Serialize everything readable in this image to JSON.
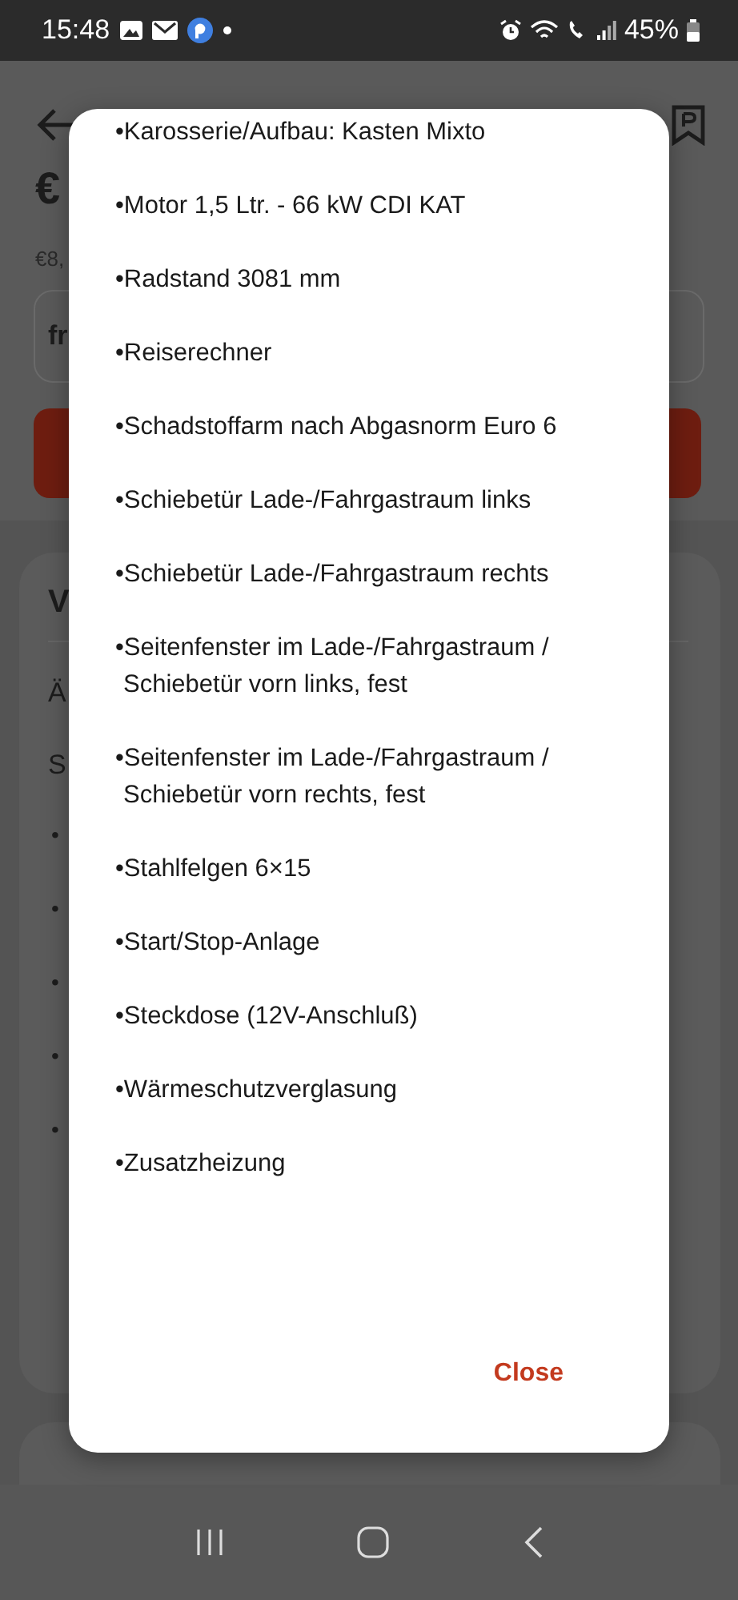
{
  "status_bar": {
    "time": "15:48",
    "battery": "45%"
  },
  "background": {
    "price": "€",
    "price_note": "€8,",
    "field_text": "fr",
    "section_title": "V",
    "rows": [
      "Ä",
      "S"
    ],
    "bullets": [
      "•",
      "•",
      "•",
      "•",
      "•"
    ]
  },
  "dialog": {
    "items": [
      "•Karosserie/Aufbau: Kasten Mixto",
      "•Motor 1,5 Ltr. - 66 kW CDI KAT",
      "•Radstand 3081 mm",
      "•Reiserechner",
      "•Schadstoffarm nach Abgasnorm Euro 6",
      "•Schiebetür Lade-/Fahrgastraum links",
      "•Schiebetür Lade-/Fahrgastraum rechts",
      "•Seitenfenster im Lade-/Fahrgastraum / Schiebetür vorn links, fest",
      "•Seitenfenster im Lade-/Fahrgastraum / Schiebetür vorn rechts, fest",
      "•Stahlfelgen 6×15",
      "•Start/Stop-Anlage",
      "•Steckdose (12V-Anschluß)",
      "•Wärmeschutzverglasung",
      "•Zusatzheizung"
    ],
    "close_label": "Close"
  }
}
